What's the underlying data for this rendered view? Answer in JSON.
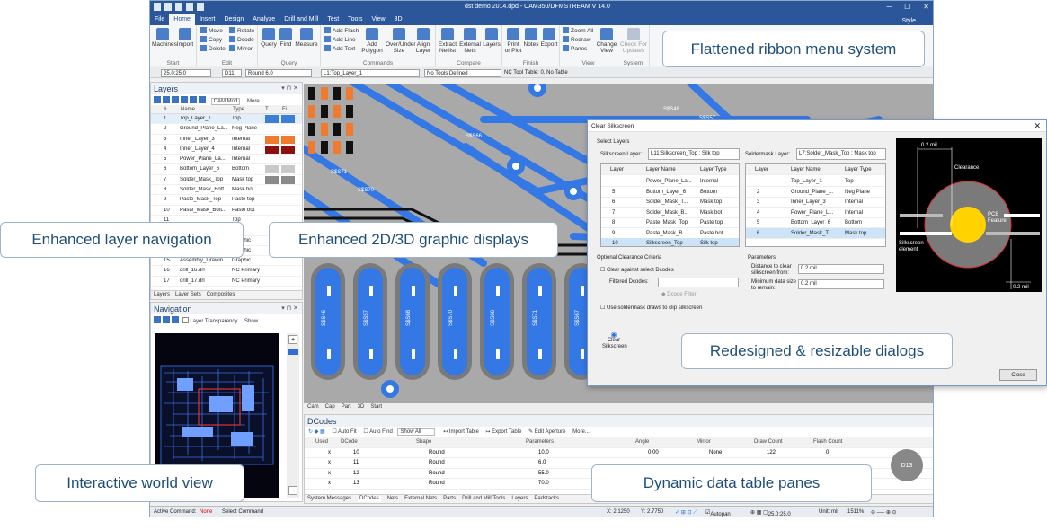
{
  "window": {
    "title": "dst demo 2014.dpd - CAM350/DFMSTREAM V 14.0",
    "style_label": "Style"
  },
  "menu": [
    "File",
    "Home",
    "Insert",
    "Design",
    "Analyze",
    "Drill and Mill",
    "Test",
    "Tools",
    "View",
    "3D"
  ],
  "ribbon": {
    "groups": [
      {
        "label": "Start",
        "buttons": [
          "Machines",
          "Import"
        ]
      },
      {
        "label": "Edit",
        "small": [
          "Move",
          "Copy",
          "Delete",
          "Rotate",
          "Dcode",
          "Mirror"
        ]
      },
      {
        "label": "Query",
        "buttons": [
          "Query",
          "Find",
          "Measure"
        ]
      },
      {
        "label": "Commands",
        "small": [
          "Add Flash",
          "Add Line",
          "Add Text"
        ],
        "buttons": [
          "Add Polygon",
          "Over/Under Size",
          "Align Layer"
        ]
      },
      {
        "label": "Compare",
        "buttons": [
          "Extract Netlist",
          "External Nets",
          "Layers"
        ]
      },
      {
        "label": "Finish",
        "buttons": [
          "Print or Plot",
          "Notes",
          "Export"
        ]
      },
      {
        "label": "View",
        "small": [
          "Zoom All",
          "Redraw",
          "Panes"
        ],
        "buttons": [
          "Change View"
        ]
      },
      {
        "label": "System",
        "buttons": [
          "Check For Updates"
        ]
      }
    ]
  },
  "toolbar2": {
    "grid": "25.0:25.0",
    "dcode": "D11",
    "dcode_shape": "Round 6.0",
    "layer": "L1:Top_Layer_1",
    "tools": "No Tools Defined",
    "nc_table": "NC Tool Table: 0. No Table"
  },
  "layers_panel": {
    "title": "Layers",
    "cam_mode": "CAM Mod",
    "more": "More...",
    "headers": {
      "num": "#",
      "name": "Name",
      "type": "Type",
      "t": "T...",
      "fi": "Fi..."
    },
    "rows": [
      {
        "num": "1",
        "name": "Top_Layer_1",
        "type": "Top",
        "color": "#3c7fd8"
      },
      {
        "num": "2",
        "name": "Ground_Plane_La...",
        "type": "Neg Plane",
        "color": ""
      },
      {
        "num": "3",
        "name": "Inner_Layer_3",
        "type": "Internal",
        "color": "#f07a30"
      },
      {
        "num": "4",
        "name": "Inner_Layer_4",
        "type": "Internal",
        "color": "#8b1010"
      },
      {
        "num": "5",
        "name": "Power_Plane_La...",
        "type": "Internal",
        "color": ""
      },
      {
        "num": "6",
        "name": "Bottom_Layer_6",
        "type": "Bottom",
        "color": "#c8c8c8"
      },
      {
        "num": "7",
        "name": "Solder_Mask_Top",
        "type": "Mask top",
        "color": "#8a8a8a"
      },
      {
        "num": "8",
        "name": "Solder_Mask_Bott...",
        "type": "Mask bot",
        "color": ""
      },
      {
        "num": "9",
        "name": "Paste_Mask_Top",
        "type": "Paste top",
        "color": ""
      },
      {
        "num": "10",
        "name": "Paste_Mask_Bott...",
        "type": "Paste bot",
        "color": ""
      },
      {
        "num": "11",
        "name": "",
        "type": "Top",
        "color": ""
      },
      {
        "num": "12",
        "name": "",
        "type": "",
        "color": ""
      },
      {
        "num": "13",
        "name": "One_Up_Border",
        "type": "Graphic",
        "color": ""
      },
      {
        "num": "14",
        "name": "",
        "type": "Graphic",
        "color": ""
      },
      {
        "num": "15",
        "name": "Assembly_Drawin...",
        "type": "Graphic",
        "color": ""
      },
      {
        "num": "16",
        "name": "drill_16.drl",
        "type": "NC Primary",
        "color": ""
      },
      {
        "num": "17",
        "name": "drill_17.drl",
        "type": "NC Primary",
        "color": ""
      }
    ],
    "tabs": [
      "Layers",
      "Layer Sets",
      "Composites"
    ]
  },
  "navigation_panel": {
    "title": "Navigation",
    "layer_transparency": "Layer Transparency",
    "show": "Show..."
  },
  "canvas": {
    "tabs": [
      "Cam",
      "Cap",
      "Part",
      "3D",
      "Start"
    ],
    "net_labels": [
      "S$S46",
      "S$S57",
      "S$S68",
      "S$S70",
      "S$S66",
      "S$S71",
      "S$S67",
      "S$S58",
      "S$S69",
      "S$S70",
      "S$S56",
      "S$S45"
    ]
  },
  "dcodes_panel": {
    "title": "DCodes",
    "toolbar": {
      "auto_fit": "Auto Fit",
      "auto_find": "Auto Find",
      "show_all": "Show All",
      "import": "Import Table",
      "export": "Export Table",
      "edit": "Edit Aperture",
      "more": "More..."
    },
    "headers": [
      "Used",
      "DCode",
      "Shape",
      "Parameters",
      "Angle",
      "Mirror",
      "Draw Count",
      "Flash Count"
    ],
    "rows": [
      {
        "used": "x",
        "dcode": "10",
        "shape": "Round",
        "params": "10.0",
        "angle": "0.00",
        "mirror": "None",
        "draw": "122",
        "flash": "0"
      },
      {
        "used": "x",
        "dcode": "11",
        "shape": "Round",
        "params": "6.0",
        "angle": "",
        "mirror": "",
        "draw": "",
        "flash": ""
      },
      {
        "used": "x",
        "dcode": "12",
        "shape": "Round",
        "params": "55.0",
        "angle": "",
        "mirror": "",
        "draw": "",
        "flash": ""
      },
      {
        "used": "x",
        "dcode": "13",
        "shape": "Round",
        "params": "70.0",
        "angle": "",
        "mirror": "",
        "draw": "",
        "flash": ""
      }
    ],
    "tabs": [
      "System Messages",
      "DCodes",
      "Nets",
      "External Nets",
      "Parts",
      "Drill and Mill Tools",
      "Layers",
      "Padstacks"
    ],
    "badge": "D13"
  },
  "statusbar": {
    "active_label": "Active Command:",
    "active_value": "None",
    "hint": "Select Command",
    "x": "X: 2.1250",
    "y": "Y: 2.7750",
    "autopan": "Autopan",
    "grid": "25.0:25.0",
    "unit": "Unit: mil",
    "zoom": "1511%"
  },
  "dialog": {
    "title": "Clear Silkscreen",
    "select_layers": "Select Layers",
    "silk_label": "Silkscreen Layer:",
    "silk_value": "L11:Silkscreen_Top  : Silk top",
    "mask_label": "Soldermask Layer:",
    "mask_value": "L7:Solder_Mask_Top  : Mask top",
    "table_headers": [
      "Layer",
      "Layer Name",
      "Layer Type"
    ],
    "left_rows": [
      {
        "layer": "",
        "name": "Power_Plane_La...",
        "type": "Internal"
      },
      {
        "layer": "5",
        "name": "Bottom_Layer_6",
        "type": "Bottom"
      },
      {
        "layer": "6",
        "name": "Solder_Mask_T...",
        "type": "Mask top"
      },
      {
        "layer": "7",
        "name": "Solder_Mask_B...",
        "type": "Mask bot"
      },
      {
        "layer": "8",
        "name": "Paste_Mask_Top",
        "type": "Paste top"
      },
      {
        "layer": "9",
        "name": "Paste_Mask_B...",
        "type": "Paste bot"
      },
      {
        "layer": "10",
        "name": "Silkscreen_Top",
        "type": "Silk top"
      }
    ],
    "right_rows": [
      {
        "layer": "",
        "name": "Top_Layer_1",
        "type": "Top"
      },
      {
        "layer": "2",
        "name": "Ground_Plane_...",
        "type": "Neg Plane"
      },
      {
        "layer": "3",
        "name": "Inner_Layer_3",
        "type": "Internal"
      },
      {
        "layer": "4",
        "name": "Power_Plane_L...",
        "type": "Internal"
      },
      {
        "layer": "5",
        "name": "Bottom_Layer_6",
        "type": "Bottom"
      },
      {
        "layer": "6",
        "name": "Solder_Mask_T...",
        "type": "Mask top"
      }
    ],
    "optional": "Optional Clearance Criteria",
    "clear_against": "Clear against select Dcodes",
    "filtered": "Filtered Dcodes:",
    "dcode_filter": "Dcode Filter",
    "use_soldermask": "Use soldermask draws to clip silkscreen",
    "parameters": "Parameters",
    "dist_label": "Distance to clear silkscreen from:",
    "dist_value": "0.2 mil",
    "min_label": "Minimum data size to remain:",
    "min_value": "0.2 mil",
    "clear_button": "Clear Silkscreen",
    "close_button": "Close",
    "preview": {
      "top_dim": "0.2 mil",
      "clearance": "Clearance",
      "pcb": "PCB Feature",
      "silk": "Silkscreen element",
      "bottom_dim": "0.2 mil"
    }
  },
  "callouts": {
    "ribbon": "Flattened ribbon menu system",
    "layer_nav": "Enhanced layer navigation",
    "graphics": "Enhanced 2D/3D graphic displays",
    "dialogs": "Redesigned & resizable dialogs",
    "world": "Interactive world view",
    "tables": "Dynamic data table panes"
  }
}
